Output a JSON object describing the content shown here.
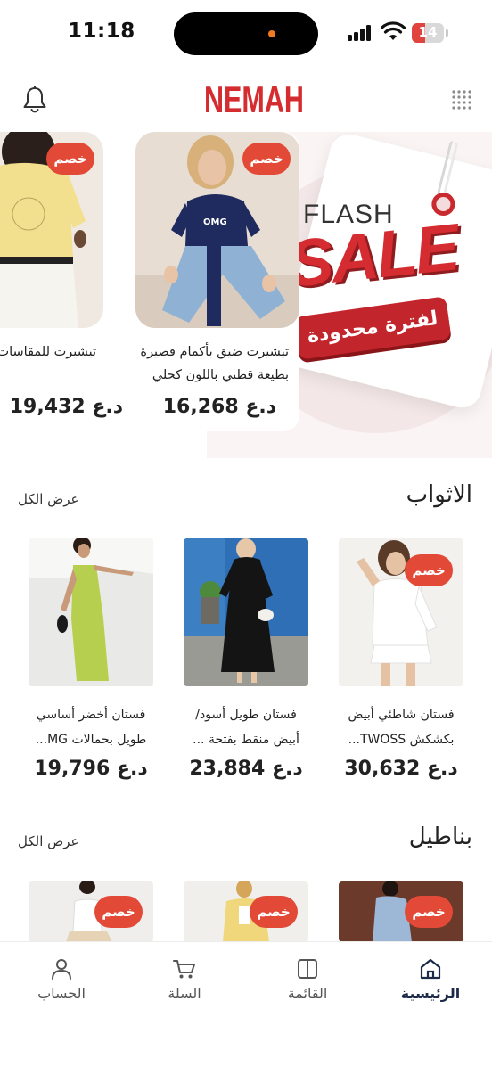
{
  "status_bar": {
    "time": "11:18",
    "battery_level": "14",
    "battery_fraction": 0.14
  },
  "header": {
    "logo_text": "NEMAH",
    "brand_color": "#d42c2f"
  },
  "flash_sale": {
    "word_top": "FLASH",
    "word_main": "SALE",
    "ribbon": "لفترة محدودة"
  },
  "carousel": [
    {
      "name": "تيشيرت ضيق بأكمام قصيرة بطيعة قطني باللون كحلي",
      "price": "16,268 د.ع",
      "badge": "خصم",
      "image_icon": "navy-tshirt-photo"
    },
    {
      "name": "تيشيرت للمقاسات أوفر سايز برقبة دائ",
      "price": "19,432 د.ع",
      "badge": "خصم",
      "image_icon": "yellow-tshirt-photo"
    }
  ],
  "dresses": {
    "title": "الاثواب",
    "see_all": "عرض الكل",
    "items": [
      {
        "name": "فستان شاطئي أبيض بكشكش TWOSS...",
        "price": "30,632 د.ع",
        "badge": "خصم",
        "image_icon": "white-dress-photo"
      },
      {
        "name": "فستان طويل أسود/ أبيض منقط بفتحة ...",
        "price": "23,884 د.ع",
        "badge": "",
        "image_icon": "black-dress-photo"
      },
      {
        "name": "فستان أخضر أساسي طويل بحمالات MG...",
        "price": "19,796 د.ع",
        "badge": "",
        "image_icon": "green-dress-photo"
      }
    ]
  },
  "pants": {
    "title": "بناطيل",
    "see_all": "عرض الكل",
    "items": [
      {
        "badge": "خصم",
        "image_icon": "denim-set-photo"
      },
      {
        "badge": "خصم",
        "image_icon": "yellow-set-photo"
      },
      {
        "badge": "خصم",
        "image_icon": "white-top-photo"
      }
    ]
  },
  "tabbar": {
    "home": "الرئيسية",
    "menu": "القائمة",
    "cart": "السلة",
    "account": "الحساب"
  }
}
